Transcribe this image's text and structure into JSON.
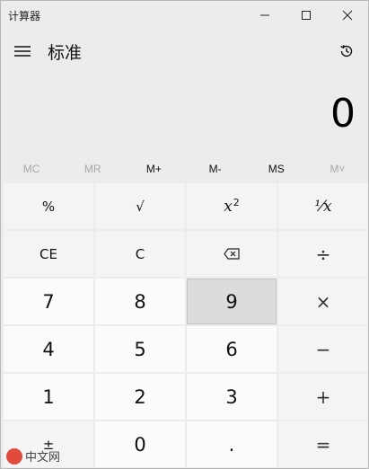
{
  "window": {
    "title": "计算器"
  },
  "header": {
    "mode": "标准"
  },
  "display": {
    "value": "0"
  },
  "memory": [
    {
      "label": "MC",
      "enabled": false
    },
    {
      "label": "MR",
      "enabled": false
    },
    {
      "label": "M+",
      "enabled": true
    },
    {
      "label": "M-",
      "enabled": true
    },
    {
      "label": "MS",
      "enabled": true
    },
    {
      "label": "M˅",
      "enabled": false
    }
  ],
  "keys": {
    "percent": "%",
    "sqrt": "√",
    "square_base": "x",
    "square_exp": "2",
    "reciprocal": "⅟x",
    "ce": "CE",
    "c": "C",
    "divide": "÷",
    "multiply": "×",
    "minus": "−",
    "plus": "+",
    "equals": "=",
    "negate": "±",
    "decimal": ".",
    "d7": "7",
    "d8": "8",
    "d9": "9",
    "d4": "4",
    "d5": "5",
    "d6": "6",
    "d1": "1",
    "d2": "2",
    "d3": "3",
    "d0": "0"
  },
  "watermark": {
    "text": "中文网"
  }
}
